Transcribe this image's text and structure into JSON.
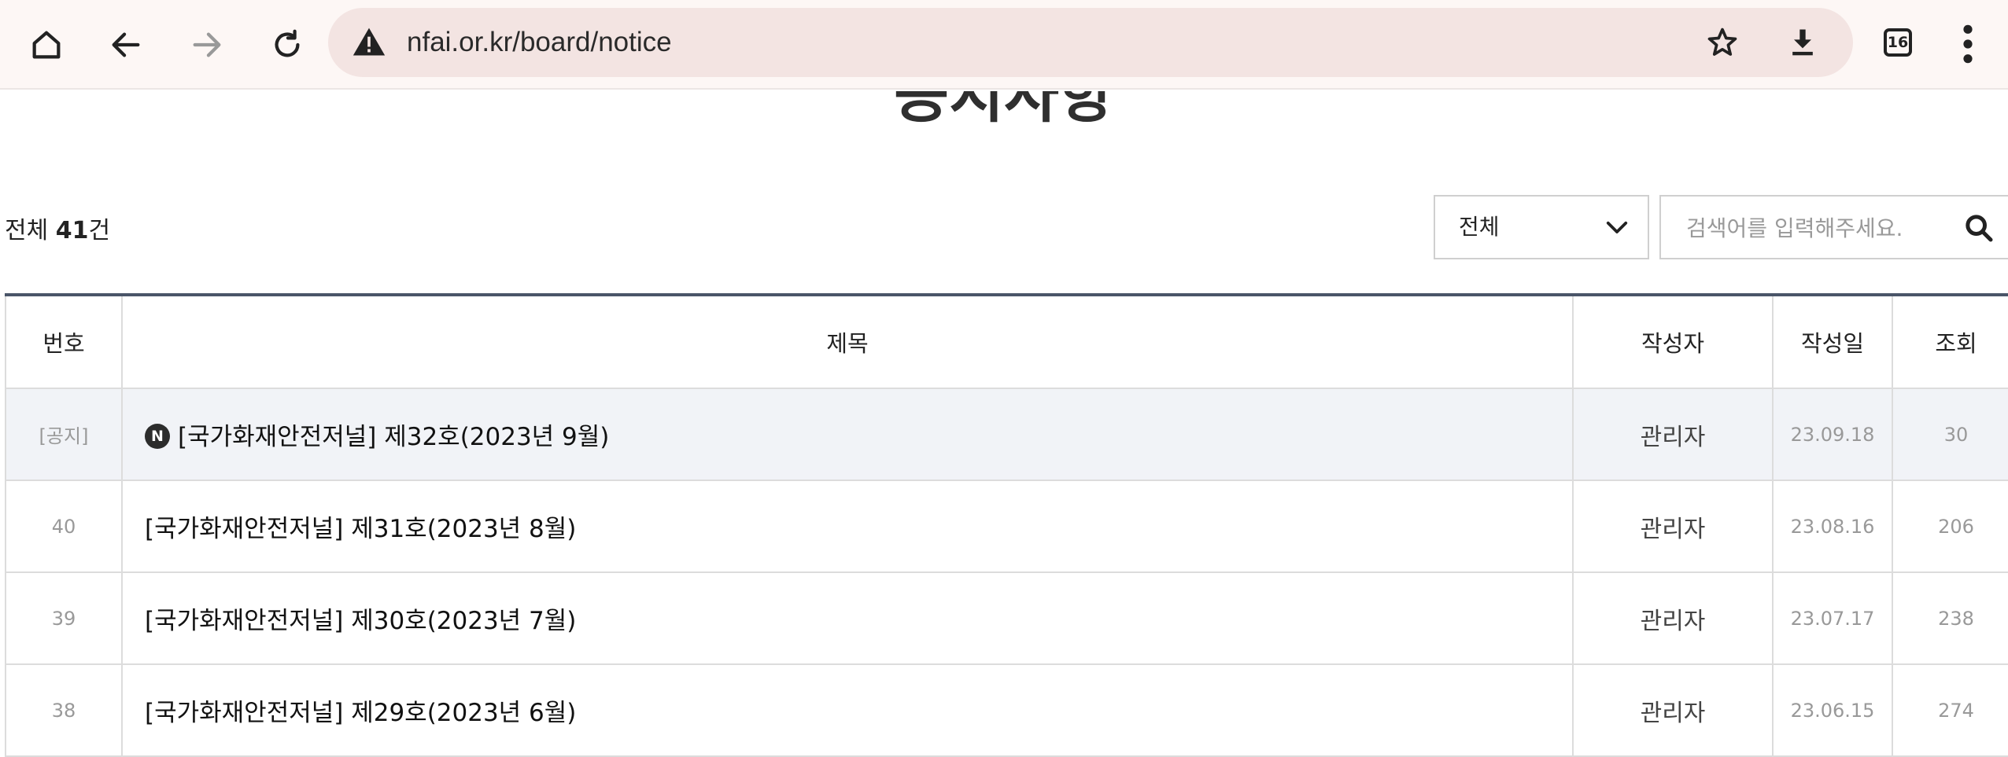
{
  "browser": {
    "url": "nfai.or.kr/board/notice",
    "tab_count": "16",
    "icons": [
      "home-icon",
      "back-icon",
      "forward-icon",
      "reload-icon",
      "not-secure-warning-icon",
      "bookmark-star-icon",
      "download-icon",
      "tabs-icon",
      "menu-icon"
    ]
  },
  "page": {
    "title": "공지사항",
    "total_prefix": "전체 ",
    "total_count": "41",
    "total_suffix": "건"
  },
  "search": {
    "filter_selected": "전체",
    "placeholder": "검색어를 입력해주세요."
  },
  "table": {
    "headers": {
      "num": "번호",
      "title": "제목",
      "author": "작성자",
      "date": "작성일",
      "views": "조회"
    },
    "rows": [
      {
        "num": "[공지]",
        "badge": "N",
        "title": "[국가화재안전저널] 제32호(2023년 9월)",
        "author": "관리자",
        "date": "23.09.18",
        "views": "30"
      },
      {
        "num": "40",
        "title": "[국가화재안전저널] 제31호(2023년 8월)",
        "author": "관리자",
        "date": "23.08.16",
        "views": "206"
      },
      {
        "num": "39",
        "title": "[국가화재안전저널] 제30호(2023년 7월)",
        "author": "관리자",
        "date": "23.07.17",
        "views": "238"
      },
      {
        "num": "38",
        "title": "[국가화재안전저널] 제29호(2023년 6월)",
        "author": "관리자",
        "date": "23.06.15",
        "views": "274"
      }
    ]
  },
  "colors": {
    "chrome_bg": "#fdf7f5",
    "omnibox_bg": "#f3e4e2",
    "table_top_border": "#4a5568",
    "notice_row_bg": "#f1f3f7"
  }
}
